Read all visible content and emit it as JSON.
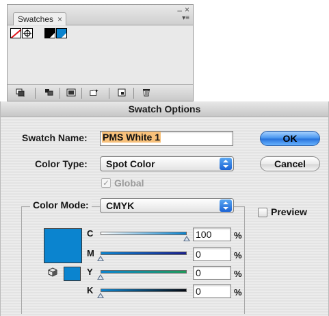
{
  "swatches_panel": {
    "tab_label": "Swatches",
    "tab_close": "×",
    "collapse_glyph": "–",
    "close_glyph": "×",
    "menu_glyph": "▾≡",
    "swatches": [
      {
        "name": "[None]",
        "icon": "none-swatch-icon"
      },
      {
        "name": "[Registration]",
        "icon": "registration-icon"
      },
      {
        "name": "Black",
        "color": "#000000"
      },
      {
        "name": "PMS White 1",
        "color": "#0b84cf"
      }
    ],
    "toolbar_icons": [
      "swatch-libraries-menu-icon",
      "show-swatch-kinds-icon",
      "swatch-options-icon",
      "new-color-group-icon",
      "new-swatch-icon",
      "delete-swatch-icon"
    ]
  },
  "dialog": {
    "title": "Swatch Options",
    "swatch_name_label": "Swatch Name:",
    "swatch_name_value": "PMS White 1",
    "color_type_label": "Color Type:",
    "color_type_value": "Spot Color",
    "global_label": "Global",
    "global_checked": true,
    "global_check_glyph": "✓",
    "color_mode_label": "Color Mode:",
    "color_mode_value": "CMYK",
    "ok_label": "OK",
    "cancel_label": "Cancel",
    "preview_label": "Preview",
    "preview_checked": false,
    "swatch_color": "#0b84cf",
    "channels": [
      {
        "label": "C",
        "value": "100",
        "unit": "%",
        "level": 1.0
      },
      {
        "label": "M",
        "value": "0",
        "unit": "%",
        "level": 0.0
      },
      {
        "label": "Y",
        "value": "0",
        "unit": "%",
        "level": 0.0
      },
      {
        "label": "K",
        "value": "0",
        "unit": "%",
        "level": 0.0
      }
    ]
  }
}
